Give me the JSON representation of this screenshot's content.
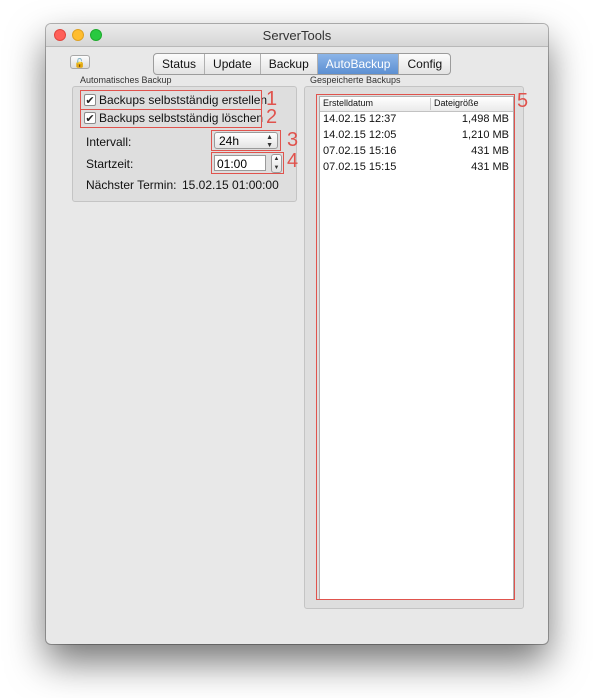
{
  "window": {
    "title": "ServerTools"
  },
  "tabs": [
    {
      "label": "Status"
    },
    {
      "label": "Update"
    },
    {
      "label": "Backup"
    },
    {
      "label": "AutoBackup",
      "active": true
    },
    {
      "label": "Config"
    }
  ],
  "auto_backup": {
    "group_label": "Automatisches Backup",
    "create_checkbox": {
      "label": "Backups selbstständig erstellen",
      "checked": true
    },
    "delete_checkbox": {
      "label": "Backups selbstständig löschen",
      "checked": true
    },
    "interval_label": "Intervall:",
    "interval_value": "24h",
    "start_label": "Startzeit:",
    "start_value": "01:00",
    "next_label": "Nächster Termin:",
    "next_value": "15.02.15 01:00:00"
  },
  "saved_backups": {
    "group_label": "Gespeicherte Backups",
    "columns": [
      "Erstelldatum",
      "Dateigröße"
    ],
    "rows": [
      {
        "date": "14.02.15 12:37",
        "size": "1,498 MB"
      },
      {
        "date": "14.02.15 12:05",
        "size": "1,210 MB"
      },
      {
        "date": "07.02.15 15:16",
        "size": "431 MB"
      },
      {
        "date": "07.02.15 15:15",
        "size": "431 MB"
      }
    ]
  },
  "annotations": [
    "1",
    "2",
    "3",
    "4",
    "5"
  ],
  "icons": {
    "lock": "lock-icon",
    "check": "✔",
    "popup_arrows": "▲▼"
  },
  "colors": {
    "accent": "#5c8fd2",
    "annotation": "#e0534d"
  }
}
